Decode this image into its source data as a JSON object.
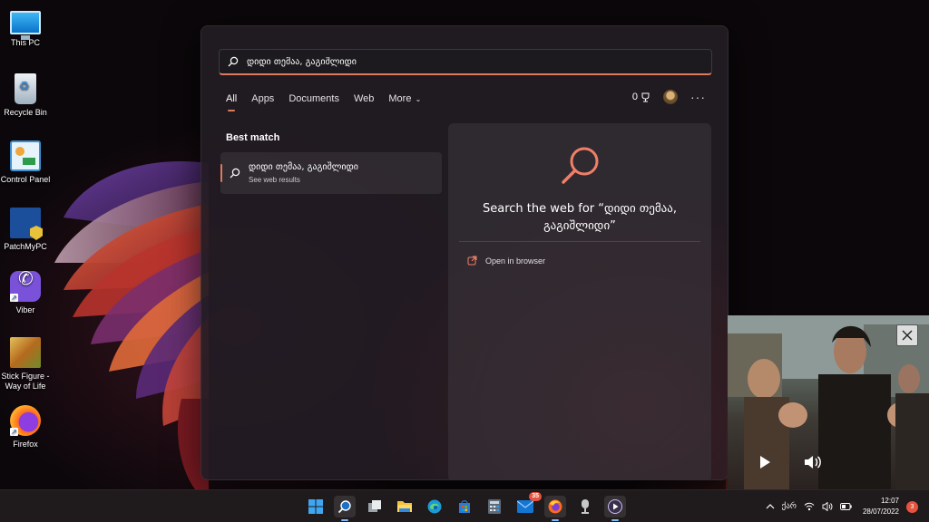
{
  "desktop": {
    "icons": [
      {
        "label": "This PC",
        "icon": "monitor-icon"
      },
      {
        "label": "Recycle Bin",
        "icon": "recycle-bin-icon"
      },
      {
        "label": "Control Panel",
        "icon": "control-panel-icon"
      },
      {
        "label": "PatchMyPC",
        "icon": "patchmypc-icon"
      },
      {
        "label": "Viber",
        "icon": "viber-icon"
      },
      {
        "label": "Stick Figure - Way of Life",
        "icon": "game-icon"
      },
      {
        "label": "Firefox",
        "icon": "firefox-icon"
      }
    ]
  },
  "search": {
    "query": "დიდი თემაა, გაგიშლიდი",
    "tabs": [
      {
        "label": "All",
        "active": true
      },
      {
        "label": "Apps",
        "active": false
      },
      {
        "label": "Documents",
        "active": false
      },
      {
        "label": "Web",
        "active": false
      },
      {
        "label": "More",
        "active": false
      }
    ],
    "rewards_points": "0",
    "best_match_label": "Best match",
    "result": {
      "title": "დიდი თემაა, გაგიშლიდი",
      "subtitle": "See web results"
    },
    "preview": {
      "title": "Search the web for “დიდი თემაა, გაგიშლიდი”",
      "open_in_browser": "Open in browser"
    },
    "accent_color": "#e07a5f"
  },
  "taskbar": {
    "pinned": [
      "windows-start-icon",
      "search-icon",
      "task-view-icon",
      "file-explorer-icon",
      "edge-icon",
      "store-icon",
      "calculator-icon",
      "mail-icon",
      "firefox-icon",
      "media-app-icon",
      "media-player-icon"
    ],
    "mail_badge": "35",
    "tray": {
      "language": "ქარ",
      "time": "12:07",
      "date": "28/07/2022",
      "notifications": "3"
    }
  }
}
